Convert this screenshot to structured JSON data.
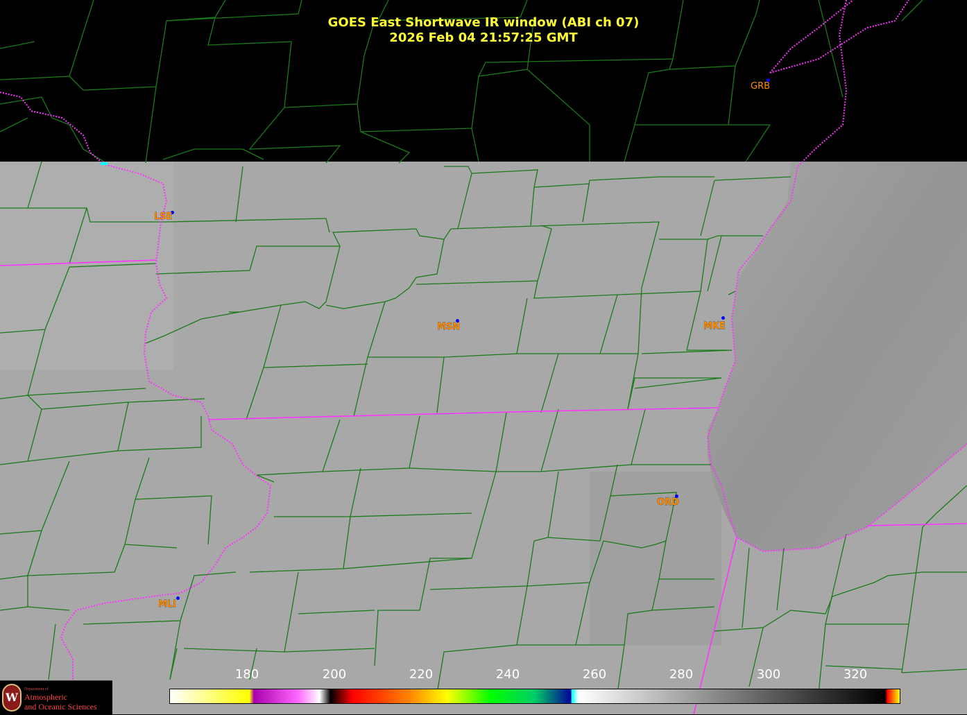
{
  "title": {
    "line1": "GOES East Shortwave IR window (ABI ch 07)",
    "line2": "2026 Feb 04  21:57:25 GMT"
  },
  "stations": [
    {
      "id": "LSE",
      "label": "LSE"
    },
    {
      "id": "MSN",
      "label": "MSN"
    },
    {
      "id": "MKE",
      "label": "MKE"
    },
    {
      "id": "GRB",
      "label": "GRB"
    },
    {
      "id": "ORD",
      "label": "ORD"
    },
    {
      "id": "MLI",
      "label": "MLI"
    }
  ],
  "colorbar": {
    "ticks": [
      "180",
      "200",
      "220",
      "240",
      "260",
      "280",
      "300",
      "320"
    ],
    "stops": [
      "#ffffff",
      "#ffff00",
      "#aa00aa",
      "#ff66ff",
      "#ffffff",
      "#000000",
      "#ff0000",
      "#ff8800",
      "#ffff00",
      "#00ff00",
      "#00cc66",
      "#000099",
      "#00ffff",
      "#ffffff",
      "#888888",
      "#000000",
      "#ff0000",
      "#ffff00"
    ]
  },
  "logo": {
    "dept": "Department of",
    "line1": "Atmospheric",
    "line2": "and Oceanic Sciences",
    "seal_letter": "W"
  },
  "colors": {
    "title": "#ffff33",
    "county_lines": "#1a7a1a",
    "state_lines": "#ff33ff",
    "station_label": "#ff8c00",
    "station_dot": "#0000ff"
  }
}
